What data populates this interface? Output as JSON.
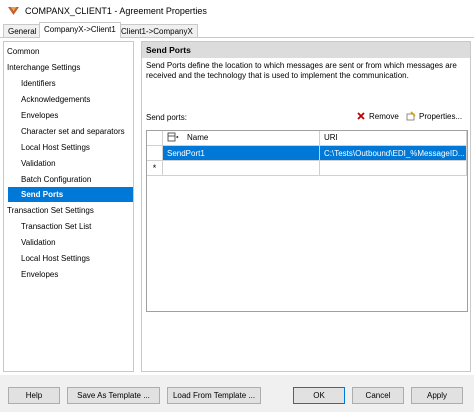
{
  "window": {
    "title": "COMPANX_CLIENT1 - Agreement Properties"
  },
  "tabs": [
    "General",
    "CompanyX->Client1",
    "Client1->CompanyX"
  ],
  "tree": {
    "items": [
      "Common",
      "Interchange Settings",
      "Identifiers",
      "Acknowledgements",
      "Envelopes",
      "Character set and separators",
      "Local Host Settings",
      "Validation",
      "Batch Configuration",
      "Send Ports",
      "Transaction Set Settings",
      "Transaction Set List",
      "Validation",
      "Local Host Settings",
      "Envelopes"
    ],
    "selected": "Send Ports"
  },
  "panel": {
    "header": "Send Ports",
    "description": "Send Ports define the location to which messages are sent or from which messages are received and the technology that is used to implement the communication.",
    "send_ports_label": "Send ports:",
    "remove_label": "Remove",
    "properties_label": "Properties..."
  },
  "grid": {
    "columns": [
      "Name",
      "URI"
    ],
    "rows": [
      {
        "name": "SendPort1",
        "uri": "C:\\Tests\\Outbound\\EDI_%MessageID..."
      }
    ],
    "new_row_marker": "*"
  },
  "footer": {
    "help": "Help",
    "save_as_template": "Save As Template ...",
    "load_from_template": "Load From Template ...",
    "ok": "OK",
    "cancel": "Cancel",
    "apply": "Apply"
  },
  "colors": {
    "selection": "#0078d7",
    "header_bg": "#dcdcdc",
    "footer_bg": "#f0f0f0"
  }
}
